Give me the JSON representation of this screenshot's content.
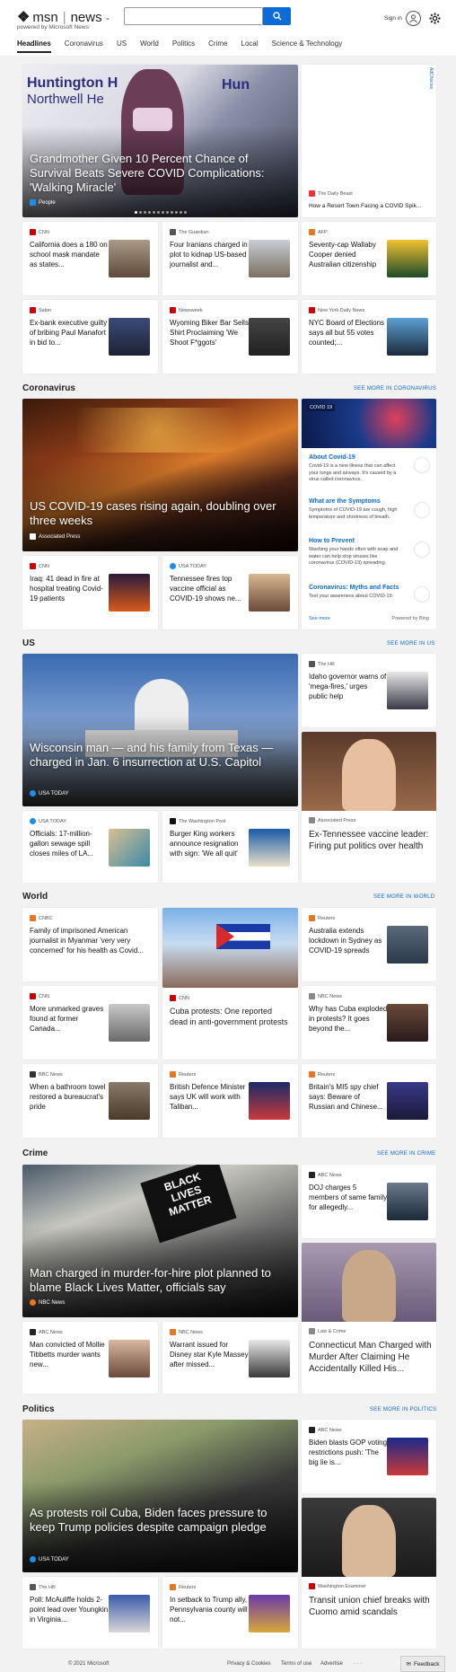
{
  "header": {
    "brand_msn": "msn",
    "brand_news": "news",
    "powered": "powered by Microsoft News",
    "signin": "Sign in"
  },
  "nav": [
    "Headlines",
    "Coronavirus",
    "US",
    "World",
    "Politics",
    "Crime",
    "Local",
    "Science & Technology"
  ],
  "hero": {
    "title": "Grandmother Given 10 Percent Chance of Survival Beats Severe COVID Complications: 'Walking Miracle'",
    "source": "People"
  },
  "ad": {
    "label": "AdChoices",
    "source": "The Daily Beast",
    "title": "How a Resort Town Facing a COVID Spik..."
  },
  "headlines_row1": [
    {
      "source": "CNN",
      "title": "California does a 180 on school mask mandate as states..."
    },
    {
      "source": "The Guardian",
      "title": "Four Iranians charged in plot to kidnap US-based journalist and..."
    },
    {
      "source": "AFP",
      "title": "Seventy-cap Wallaby Cooper denied Australian citizenship"
    }
  ],
  "headlines_row2": [
    {
      "source": "Salon",
      "title": "Ex-bank executive guilty of bribing Paul Manafort in bid to..."
    },
    {
      "source": "Newsweek",
      "title": "Wyoming Biker Bar Sells Shirt Proclaiming 'We Shoot F*ggots'"
    },
    {
      "source": "New York Daily News",
      "title": "NYC Board of Elections says all but 55 votes counted;..."
    }
  ],
  "coronavirus": {
    "section": "Coronavirus",
    "see_more": "SEE MORE IN CORONAVIRUS",
    "hero": {
      "title": "US COVID-19 cases rising again, doubling over three weeks",
      "source": "Associated Press"
    },
    "cards": [
      {
        "source": "CNN",
        "title": "Iraq: 41 dead in fire at hospital treating Covid-19 patients"
      },
      {
        "source": "USA TODAY",
        "title": "Tennessee fires top vaccine official as COVID-19 shows ne..."
      }
    ],
    "panel": {
      "tag": "COVID 19",
      "items": [
        {
          "h": "About Covid-19",
          "d": "Covid-19 is a new illness that can affect your lungs and airways. It's caused by a virus called coronavirus."
        },
        {
          "h": "What are the Symptoms",
          "d": "Symptoms of COVID-19 are cough, high temperature and shortness of breath."
        },
        {
          "h": "How to Prevent",
          "d": "Washing your hands often with soap and water can help stop viruses like coronavirus (COVID-19) spreading."
        },
        {
          "h": "Coronavirus: Myths and Facts",
          "d": "Test your awareness about COVID-19."
        }
      ],
      "see_more": "See more",
      "powered": "Powered by Bing"
    }
  },
  "us": {
    "section": "US",
    "see_more": "SEE MORE IN US",
    "hero": {
      "title": "Wisconsin man — and his family from Texas — charged in Jan. 6 insurrection at U.S. Capitol",
      "source": "USA TODAY"
    },
    "side1": {
      "source": "The Hill",
      "title": "Idaho governor warns of 'mega-fires,' urges public help"
    },
    "side2": {
      "source": "Associated Press",
      "title": "Ex-Tennessee vaccine leader: Firing put politics over health"
    },
    "cards": [
      {
        "source": "USA TODAY",
        "title": "Officials: 17-million-gallon sewage spill closes miles of LA..."
      },
      {
        "source": "The Washington Post",
        "title": "Burger King workers announce resignation with sign: 'We all quit'"
      }
    ]
  },
  "world": {
    "section": "World",
    "see_more": "SEE MORE IN WORLD",
    "row1": [
      {
        "source": "CNBC",
        "title": "Family of imprisoned American journalist in Myanmar 'very very concerned' for his health as Covid..."
      },
      {
        "source": "Reuters",
        "title": "Australia extends lockdown in Sydney as COVID-19 spreads"
      }
    ],
    "row2": [
      {
        "source": "CNN",
        "title": "More unmarked graves found at former Canada..."
      },
      {
        "source": "CNN",
        "title": "Cuba protests: One reported dead in anti-government protests"
      },
      {
        "source": "NBC News",
        "title": "Why has Cuba exploded in protests? It goes beyond the..."
      }
    ],
    "row3": [
      {
        "source": "BBC News",
        "title": "When a bathroom towel restored a bureaucrat's pride"
      },
      {
        "source": "Reuters",
        "title": "British Defence Minister says UK will work with Taliban..."
      },
      {
        "source": "Reuters",
        "title": "Britain's MI5 spy chief says: Beware of Russian and Chinese..."
      }
    ]
  },
  "crime": {
    "section": "Crime",
    "see_more": "SEE MORE IN CRIME",
    "hero": {
      "title": "Man charged in murder-for-hire plot planned to blame Black Lives Matter, officials say",
      "source": "NBC News",
      "sign": "BLACK LIVES MATTER"
    },
    "side1": {
      "source": "ABC News",
      "title": "DOJ charges 5 members of same family for allegedly..."
    },
    "side2": {
      "source": "Law & Crime",
      "title": "Connecticut Man Charged with Murder After Claiming He Accidentally Killed His..."
    },
    "cards": [
      {
        "source": "ABC News",
        "title": "Man convicted of Mollie Tibbetts murder wants new..."
      },
      {
        "source": "NBC News",
        "title": "Warrant issued for Disney star Kyle Massey after missed..."
      }
    ]
  },
  "politics": {
    "section": "Politics",
    "see_more": "SEE MORE IN POLITICS",
    "hero": {
      "title": "As protests roil Cuba, Biden faces pressure to keep Trump policies despite campaign pledge",
      "source": "USA TODAY"
    },
    "side1": {
      "source": "ABC News",
      "title": "Biden blasts GOP voting restrictions push: 'The big lie is..."
    },
    "side2": {
      "source": "Washington Examiner",
      "title": "Transit union chief breaks with Cuomo amid scandals"
    },
    "cards": [
      {
        "source": "The Hill",
        "title": "Poll: McAuliffe holds 2-point lead over Youngkin in Virginia..."
      },
      {
        "source": "Reuters",
        "title": "In setback to Trump ally, Pennsylvania county will not..."
      }
    ]
  },
  "footer": {
    "copyright": "© 2021 Microsoft",
    "privacy": "Privacy & Cookies",
    "terms": "Terms of use",
    "advertise": "Advertise",
    "more": "· · ·",
    "feedback": "Feedback"
  },
  "colors": {
    "accent": "#0b6bd7",
    "bg": "#f2f2f2"
  }
}
